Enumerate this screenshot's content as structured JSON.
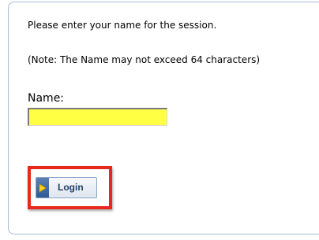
{
  "form": {
    "instruction": "Please enter your name for the session.",
    "note": "(Note: The Name may not exceed 64 characters)",
    "name_label": "Name:",
    "name_value": "",
    "login_label": "Login"
  },
  "colors": {
    "input_background": "#ffff44",
    "highlight_border": "#e8281c",
    "button_text": "#1f3f6e",
    "panel_border": "#a9bcd8"
  },
  "icons": {
    "login_icon": "play-arrow-icon"
  }
}
